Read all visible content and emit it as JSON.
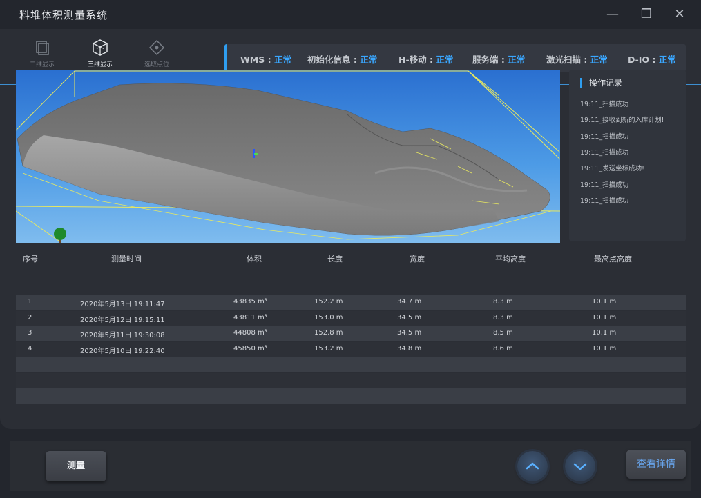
{
  "app": {
    "title": "料堆体积测量系统"
  },
  "window_controls": {
    "minimize": "—",
    "restore": "❐",
    "close": "✕"
  },
  "mode_tabs": [
    {
      "label": "二维显示",
      "icon": "2d-view-icon",
      "active": false
    },
    {
      "label": "三维显示",
      "icon": "3d-cube-icon",
      "active": true
    },
    {
      "label": "选取点位",
      "icon": "select-point-icon",
      "active": false
    }
  ],
  "status": [
    {
      "name": "WMS",
      "value": "正常"
    },
    {
      "name": "初始化信息",
      "value": "正常"
    },
    {
      "name": "H-移动",
      "value": "正常"
    },
    {
      "name": "服务端",
      "value": "正常"
    },
    {
      "name": "激光扫描",
      "value": "正常"
    },
    {
      "name": "D-IO",
      "value": "正常"
    }
  ],
  "status_separator": " : ",
  "colors": {
    "accent": "#2f9ef0",
    "status_ok": "#3aa7ff",
    "sky_top": "#2a6fd0",
    "pile": "#7a7a7a",
    "bbox_line": "#e8e860"
  },
  "log": {
    "title": "操作记录",
    "items": [
      "19:11_扫描成功",
      "19:11_接收到新的入库计划!",
      "19:11_扫描成功",
      "19:11_扫描成功",
      "19:11_发送坐标成功!",
      "19:11_扫描成功",
      "19:11_扫描成功"
    ]
  },
  "table": {
    "headers": [
      "序号",
      "测量时间",
      "体积",
      "长度",
      "宽度",
      "平均高度",
      "最高点高度"
    ],
    "rows": [
      [
        "1",
        "2020年5月13日   19:11:47",
        "43835 m³",
        "152.2 m",
        "34.7 m",
        "8.3 m",
        "10.1 m"
      ],
      [
        "2",
        "2020年5月12日   19:15:11",
        "43811 m³",
        "153.0 m",
        "34.5 m",
        "8.3 m",
        "10.1 m"
      ],
      [
        "3",
        "2020年5月11日   19:30:08",
        "44808 m³",
        "152.8 m",
        "34.5 m",
        "8.5 m",
        "10.1 m"
      ],
      [
        "4",
        "2020年5月10日   19:22:40",
        "45850 m³",
        "153.2 m",
        "34.8 m",
        "8.6 m",
        "10.1 m"
      ]
    ]
  },
  "buttons": {
    "measure": "测量",
    "up_icon": "chevron-up-icon",
    "down_icon": "chevron-down-icon",
    "detail": "查看详情"
  }
}
